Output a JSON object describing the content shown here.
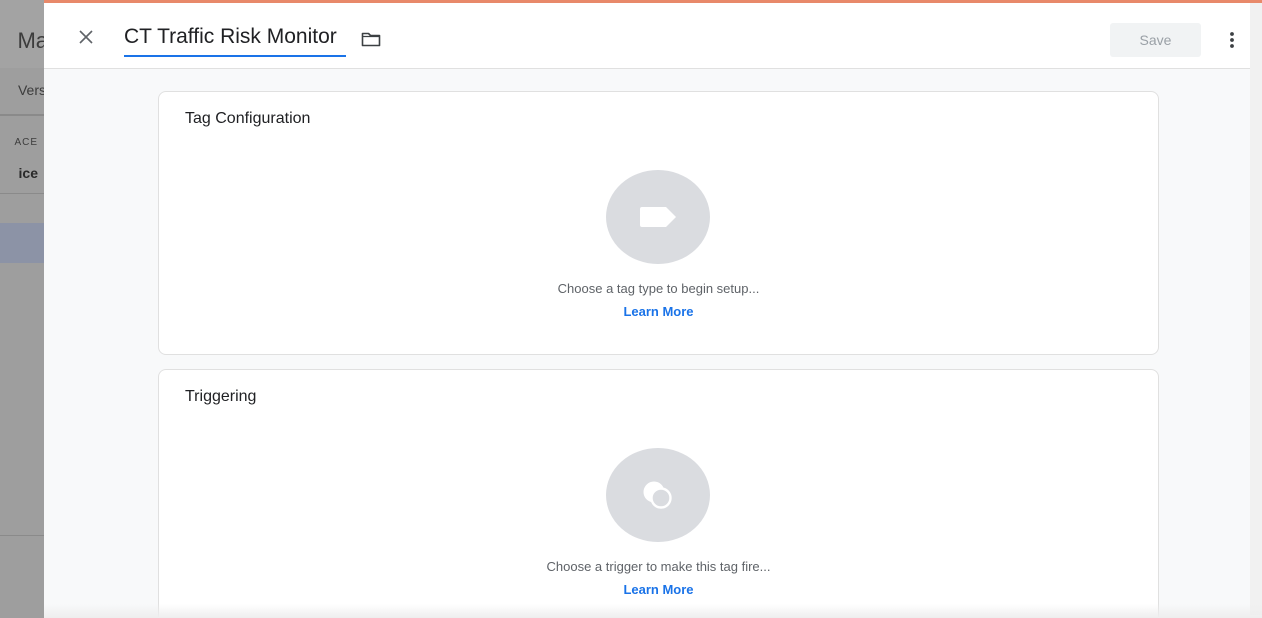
{
  "background": {
    "title_fragment": "Ma",
    "tab_fragment": "Vers",
    "workspace_label_fragment": "ACE",
    "workspace_value_fragment": "ice"
  },
  "header": {
    "close_icon": "close-icon",
    "tag_name": "CT Traffic Risk Monitor",
    "folder_icon": "folder-icon",
    "save_label": "Save",
    "more_icon": "more-vert-icon",
    "accent_color": "#e8896a"
  },
  "tag_configuration": {
    "title": "Tag Configuration",
    "icon": "tag-icon",
    "description": "Choose a tag type to begin setup...",
    "link": "Learn More"
  },
  "triggering": {
    "title": "Triggering",
    "icon": "trigger-icon",
    "description": "Choose a trigger to make this tag fire...",
    "link": "Learn More"
  },
  "colors": {
    "link": "#1a73e8",
    "icon_circle": "#dadce0"
  }
}
